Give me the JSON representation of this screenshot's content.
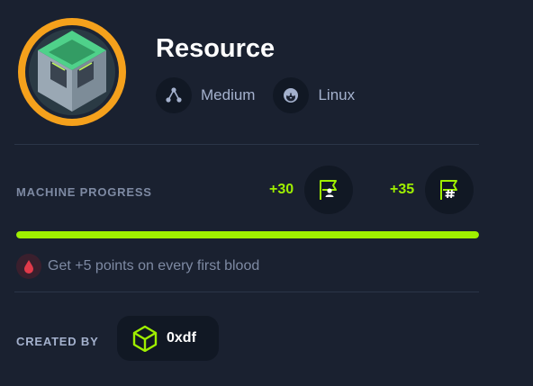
{
  "machine": {
    "name": "Resource",
    "difficulty": "Medium",
    "os": "Linux"
  },
  "progress": {
    "label": "MACHINE PROGRESS",
    "user_points": "+30",
    "root_points": "+35",
    "fill_percent": 100
  },
  "first_blood": {
    "text": "Get +5 points on every first blood"
  },
  "creator": {
    "label": "CREATED BY",
    "name": "0xdf"
  },
  "colors": {
    "accent": "#9fef00",
    "background": "#1a2130",
    "ring": "#f5a11c",
    "blood": "#e23a4a"
  },
  "icons": {
    "avatar": "resource-machine-avatar",
    "difficulty": "difficulty-nodes-icon",
    "os": "linux-penguin-icon",
    "user_flag": "user-flag-icon",
    "root_flag": "root-flag-icon",
    "blood": "blood-drop-icon",
    "creator": "creator-logo-icon"
  }
}
